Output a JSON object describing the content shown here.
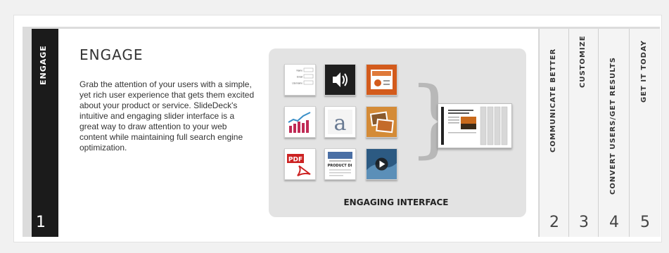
{
  "active_slide": {
    "title": "ENGAGE",
    "number": "1",
    "heading": "ENGAGE",
    "body": "Grab the attention of your users with a simple, yet rich user experience that gets them excited about your product or service. SlideDeck's intuitive and engaging slider interface is a great way to draw attention to your web content while maintaining full search engine optimization.",
    "panel_caption": "ENGAGING INTERFACE"
  },
  "form_tile": {
    "name_label": "Name",
    "email_label": "Email",
    "username_label": "Username"
  },
  "icons": [
    "form-icon",
    "speaker-icon",
    "presentation-icon",
    "bar-chart-icon",
    "letter-a-icon",
    "photo-stack-icon",
    "pdf-icon",
    "product-document-icon",
    "video-play-icon"
  ],
  "product_tile_text": "PRODUCT DI",
  "spines": [
    {
      "title": "COMMUNICATE BETTER",
      "number": "2"
    },
    {
      "title": "CUSTOMIZE",
      "number": "3"
    },
    {
      "title": "CONVERT USERS/GET RESULTS",
      "number": "4"
    },
    {
      "title": "GET IT TODAY",
      "number": "5"
    }
  ],
  "colors": {
    "active_spine": "#1b1b1b",
    "panel": "#e3e3e3",
    "ppt_orange": "#d35b1c",
    "pdf_red": "#cc2222"
  }
}
